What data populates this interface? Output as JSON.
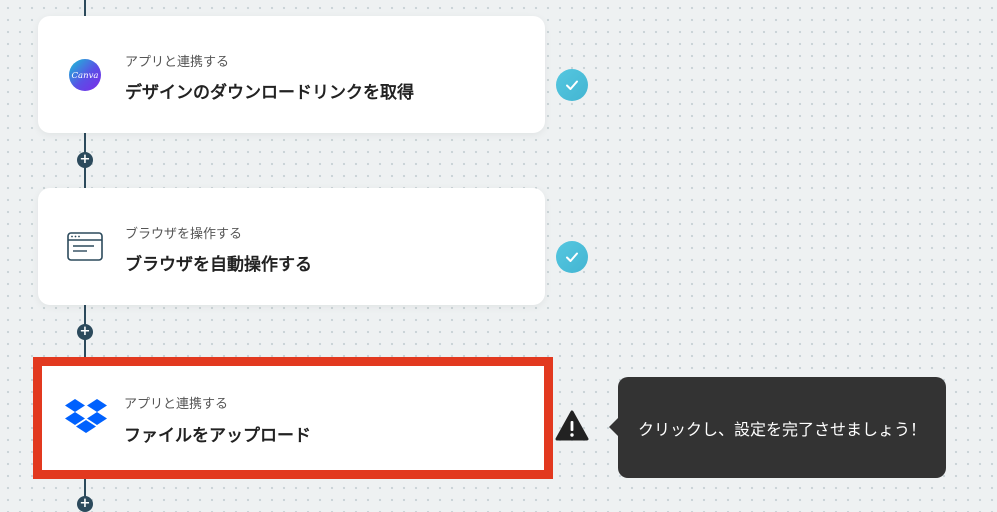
{
  "steps": [
    {
      "subtitle": "アプリと連携する",
      "title": "デザインのダウンロードリンクを取得",
      "icon": "canva-icon",
      "icon_text": "Canva",
      "status": "complete"
    },
    {
      "subtitle": "ブラウザを操作する",
      "title": "ブラウザを自動操作する",
      "icon": "browser-window-icon",
      "status": "complete"
    },
    {
      "subtitle": "アプリと連携する",
      "title": "ファイルをアップロード",
      "icon": "dropbox-icon",
      "status": "warning"
    }
  ],
  "tooltip": {
    "text": "クリックし、設定を完了させましょう！"
  },
  "colors": {
    "connector": "#2c4a5c",
    "check": "#4dbfdb",
    "highlight": "#e2391f",
    "tooltip_bg": "#333333",
    "dropbox": "#0061fe"
  }
}
